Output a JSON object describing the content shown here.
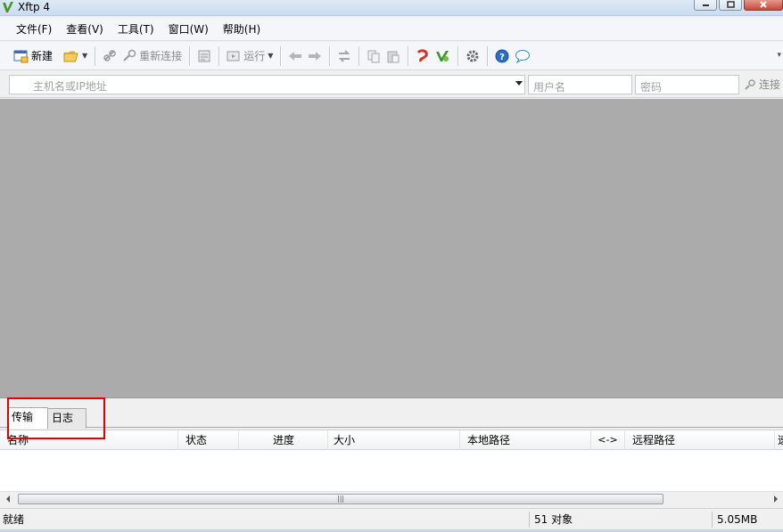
{
  "window": {
    "title": "Xftp 4"
  },
  "menubar": {
    "items": [
      "文件(F)",
      "查看(V)",
      "工具(T)",
      "窗口(W)",
      "帮助(H)"
    ]
  },
  "toolbar": {
    "new_label": "新建",
    "reconnect_label": "重新连接",
    "run_label": "运行"
  },
  "addressbar": {
    "host_placeholder": "主机名或IP地址",
    "user_placeholder": "用户名",
    "password_placeholder": "密码",
    "connect_label": "连接"
  },
  "bottom_panel": {
    "tabs": [
      {
        "label": "传输",
        "active": true
      },
      {
        "label": "日志",
        "active": false
      }
    ],
    "columns": [
      "名称",
      "状态",
      "进度",
      "大小",
      "本地路径",
      "<->",
      "远程路径",
      "速"
    ]
  },
  "statusbar": {
    "ready": "就绪",
    "objects": "51 对象",
    "size": "5.05MB"
  },
  "colors": {
    "workspace": "#ababab",
    "highlight": "#e00000"
  }
}
